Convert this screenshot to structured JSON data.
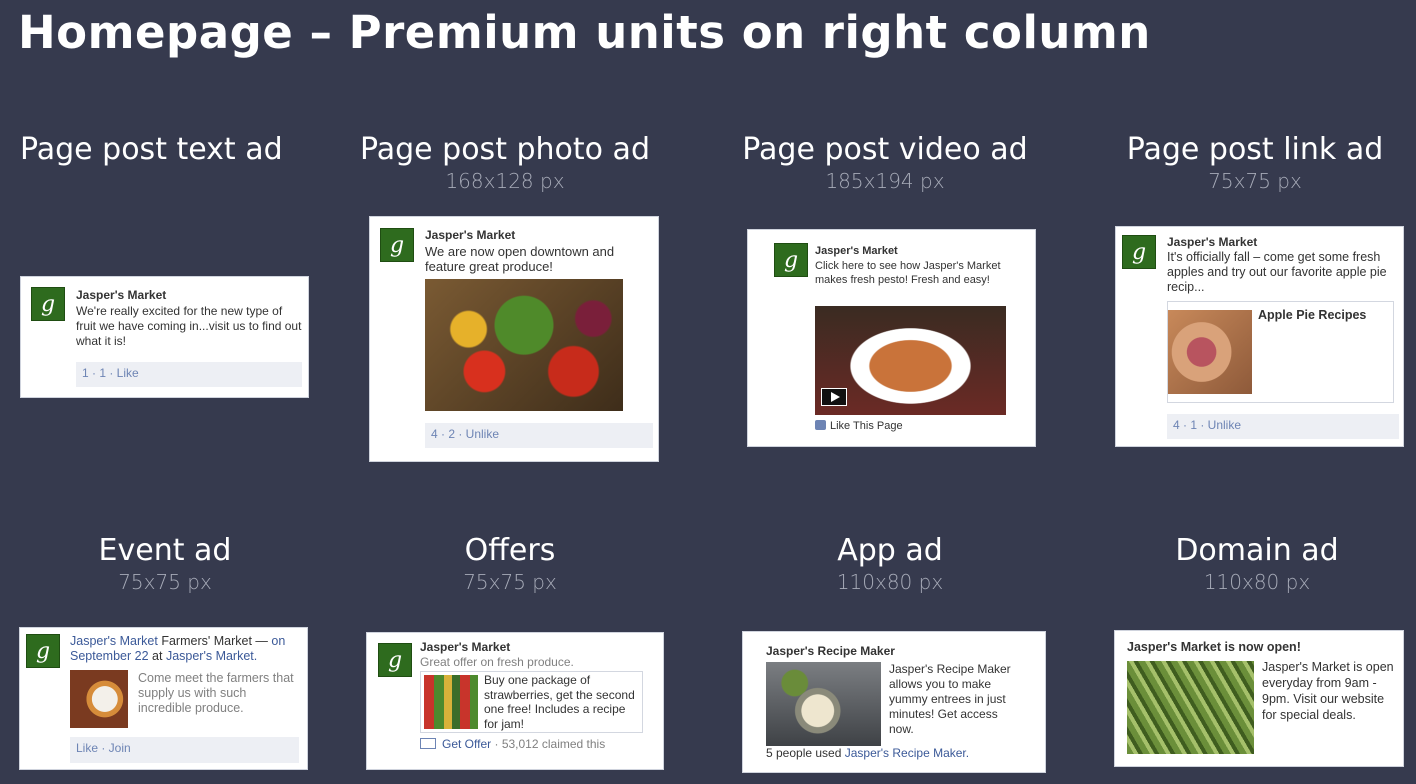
{
  "title": "Homepage – Premium units on right column",
  "brand_name": "Jasper's Market",
  "logo_letter": "g",
  "labels": {
    "text_ad": {
      "name": "Page post text ad"
    },
    "photo_ad": {
      "name": "Page post photo ad",
      "size": "168x128 px"
    },
    "video_ad": {
      "name": "Page post video ad",
      "size": "185x194 px"
    },
    "link_ad": {
      "name": "Page post link ad",
      "size": "75x75 px"
    },
    "event_ad": {
      "name": "Event ad",
      "size": "75x75 px"
    },
    "offers": {
      "name": "Offers",
      "size": "75x75 px"
    },
    "app_ad": {
      "name": "App ad",
      "size": "110x80 px"
    },
    "domain_ad": {
      "name": "Domain ad",
      "size": "110x80 px"
    }
  },
  "text_ad": {
    "body": "We're really excited for the new type of fruit we have coming in...visit us to find out what it is!",
    "social": "1 · 1 · Like"
  },
  "photo_ad": {
    "body": "We are now open downtown and feature great produce!",
    "social": "4 · 2 · Unlike"
  },
  "video_ad": {
    "body": "Click here to see how Jasper's Market makes fresh pesto! Fresh and easy!",
    "action": "Like This Page"
  },
  "link_ad": {
    "body": "It's officially fall – come get some fresh apples and try out our favorite apple pie recip...",
    "link_title": "Apple Pie Recipes",
    "social": "4 · 1 · Unlike"
  },
  "event_ad": {
    "event_name": "Farmers' Market —",
    "on": "on September 22",
    "at": "at",
    "body": "Come meet the farmers that supply us with such incredible produce.",
    "social": "Like · Join"
  },
  "offers": {
    "subtitle": "Great offer on fresh produce.",
    "offer_text": "Buy one package of strawberries, get the second one free! Includes a recipe for jam!",
    "action": "Get Offer",
    "claimed": "· 53,012 claimed this"
  },
  "app_ad": {
    "app_name": "Jasper's Recipe Maker",
    "body": "Jasper's Recipe Maker allows you to make yummy entrees in just minutes! Get access now.",
    "used_prefix": "5 people used"
  },
  "domain_ad": {
    "headline": "Jasper's Market is now open!",
    "body": "Jasper's Market is open everyday from 9am - 9pm. Visit our website for special deals."
  }
}
